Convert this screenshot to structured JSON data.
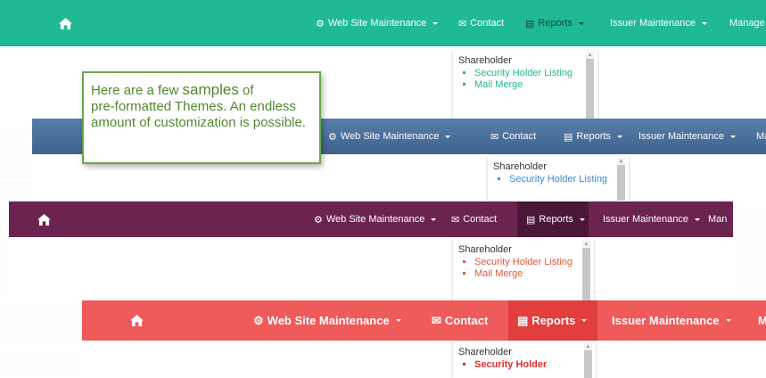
{
  "callout": {
    "line1_a": "Here are a few ",
    "line1_b": "samples",
    "line1_c": " of",
    "rest": "pre-formatted Themes.  An endless amount of customization is possible."
  },
  "themes": [
    {
      "name": "teal",
      "colors": {
        "bar": "#1fba94",
        "link": "#1fba94",
        "active": "#1fba94"
      },
      "nav": {
        "web_site_maintenance": "Web Site Maintenance",
        "contact": "Contact",
        "reports": "Reports",
        "issuer_maintenance": "Issuer Maintenance",
        "manage": "Manage"
      },
      "dropdown": {
        "header": "Shareholder",
        "items": [
          "Security Holder Listing",
          "Mail Merge"
        ]
      }
    },
    {
      "name": "steel-blue",
      "colors": {
        "bar": "#4a6f9a",
        "link": "#3b8ad9"
      },
      "nav": {
        "web_site_maintenance": "Web Site Maintenance",
        "contact": "Contact",
        "reports": "Reports",
        "issuer_maintenance": "Issuer Maintenance",
        "manage": "Ma"
      },
      "dropdown": {
        "header": "Shareholder",
        "items": [
          "Security Holder Listing"
        ]
      }
    },
    {
      "name": "plum",
      "colors": {
        "bar": "#6b2450",
        "active": "#4a1736",
        "link": "#e05a3b"
      },
      "nav": {
        "web_site_maintenance": "Web Site Maintenance",
        "contact": "Contact",
        "reports": "Reports",
        "issuer_maintenance": "Issuer Maintenance",
        "manage": "Man"
      },
      "dropdown": {
        "header": "Shareholder",
        "items": [
          "Security Holder Listing",
          "Mail Merge"
        ]
      }
    },
    {
      "name": "coral",
      "colors": {
        "bar": "#ef5a5a",
        "active": "#e23e3e",
        "link": "#e02f2f"
      },
      "nav": {
        "web_site_maintenance": "Web Site Maintenance",
        "contact": "Contact",
        "reports": "Reports",
        "issuer_maintenance": "Issuer Maintenance",
        "manage": "M"
      },
      "dropdown": {
        "header": "Shareholder",
        "items": [
          "Security Holder"
        ]
      }
    }
  ]
}
